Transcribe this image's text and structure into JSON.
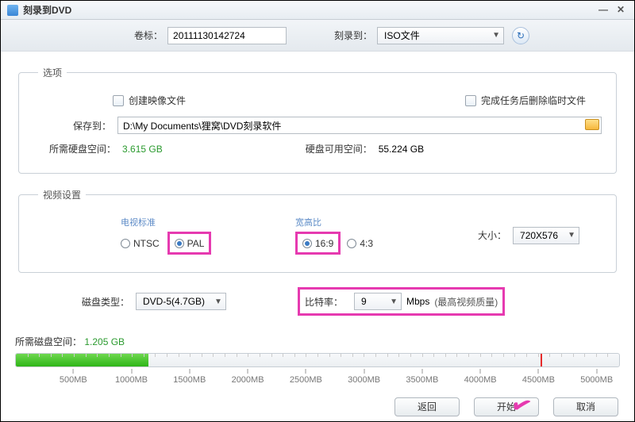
{
  "window": {
    "title": "刻录到DVD"
  },
  "top": {
    "volume_label_lbl": "卷标：",
    "volume_label_value": "20111130142724",
    "burn_to_lbl": "刻录到：",
    "burn_to_value": "ISO文件"
  },
  "options": {
    "legend": "选项",
    "create_image_label": "创建映像文件",
    "delete_temp_label": "完成任务后删除临时文件",
    "save_to_lbl": "保存到：",
    "save_to_path": "D:\\My Documents\\狸窝\\DVD刻录软件",
    "required_hd_lbl": "所需硬盘空间：",
    "required_hd_value": "3.615 GB",
    "available_hd_lbl": "硬盘可用空间：",
    "available_hd_value": "55.224 GB"
  },
  "video": {
    "legend": "视频设置",
    "tv_standard_lbl": "电视标准",
    "ntsc": "NTSC",
    "pal": "PAL",
    "aspect_lbl": "宽高比",
    "a169": "16:9",
    "a43": "4:3",
    "size_lbl": "大小：",
    "size_value": "720X576"
  },
  "disc": {
    "type_lbl": "磁盘类型：",
    "type_value": "DVD-5(4.7GB)",
    "bitrate_lbl": "比特率：",
    "bitrate_value": "9",
    "bitrate_unit": "Mbps",
    "bitrate_hint": "(最高视频质量)"
  },
  "progress": {
    "label": "所需磁盘空间：",
    "value": "1.205 GB",
    "fill_percent": 22,
    "red_marker_percent": 87,
    "ticks": [
      "500MB",
      "1000MB",
      "1500MB",
      "2000MB",
      "2500MB",
      "3000MB",
      "3500MB",
      "4000MB",
      "4500MB",
      "5000MB"
    ],
    "max_mb": 5200
  },
  "buttons": {
    "back": "返回",
    "start": "开始",
    "cancel": "取消"
  }
}
